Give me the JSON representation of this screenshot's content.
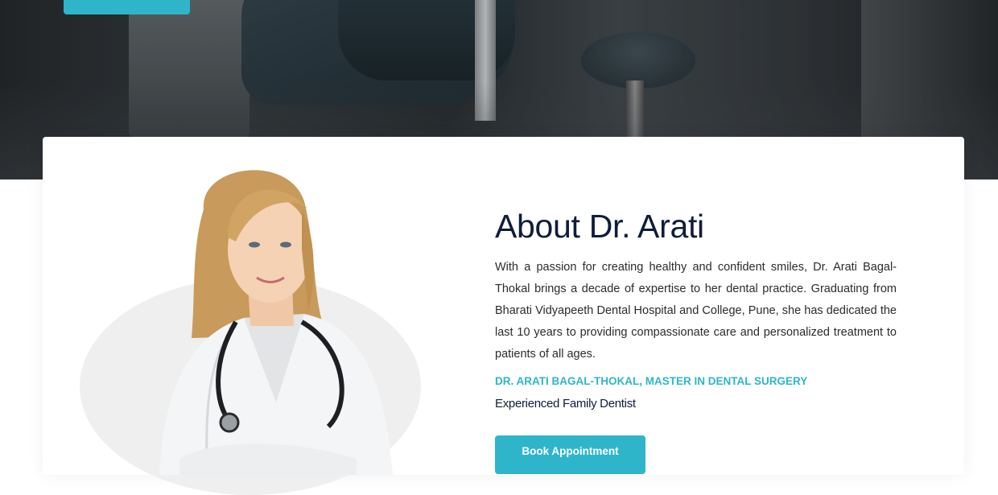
{
  "about": {
    "title": "About Dr. Arati",
    "description": "With a passion for creating healthy and confident smiles, Dr. Arati Bagal-Thokal brings a decade of expertise to her dental practice. Graduating from Bharati Vidyapeeth Dental Hospital and College, Pune, she has dedicated the last 10 years to providing compassionate care and personalized treatment to patients of all ages.",
    "credential": "DR. ARATI BAGAL-THOKAL, MASTER IN DENTAL SURGERY",
    "subtitle": "Experienced Family Dentist",
    "cta_label": "Book Appointment"
  },
  "colors": {
    "accent": "#2fb5c9",
    "heading": "#0f1d3a",
    "body_text": "#2b2b2b"
  }
}
